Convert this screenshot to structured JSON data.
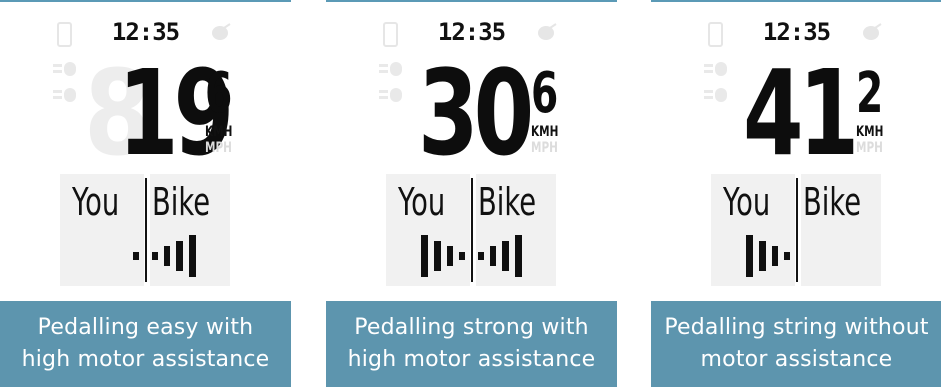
{
  "colors": {
    "caption_bg": "#5d95ae",
    "lcd_ghost": "#f1f1f1",
    "segment": "#0d0d0d",
    "top_line": "#5b9ab6"
  },
  "panels": [
    {
      "time": "12:35",
      "speed_main": "19",
      "speed_decimal": "6",
      "unit_active": "KMH",
      "unit_inactive": "MPH",
      "you_label": "You",
      "bike_label": "Bike",
      "you_level": 1,
      "bike_level": 4,
      "caption_line1": "Pedalling easy with",
      "caption_line2": "high motor assistance"
    },
    {
      "time": "12:35",
      "speed_main": "30",
      "speed_decimal": "6",
      "unit_active": "KMH",
      "unit_inactive": "MPH",
      "you_label": "You",
      "bike_label": "Bike",
      "you_level": 4,
      "bike_level": 4,
      "caption_line1": "Pedalling strong with",
      "caption_line2": "high motor assistance"
    },
    {
      "time": "12:35",
      "speed_main": "41",
      "speed_decimal": "2",
      "unit_active": "KMH",
      "unit_inactive": "MPH",
      "you_label": "You",
      "bike_label": "Bike",
      "you_level": 4,
      "bike_level": 0,
      "caption_line1": "Pedalling string without",
      "caption_line2": "motor assistance"
    }
  ],
  "icons": [
    "phone-icon",
    "satellite-icon",
    "headlight-icon"
  ]
}
